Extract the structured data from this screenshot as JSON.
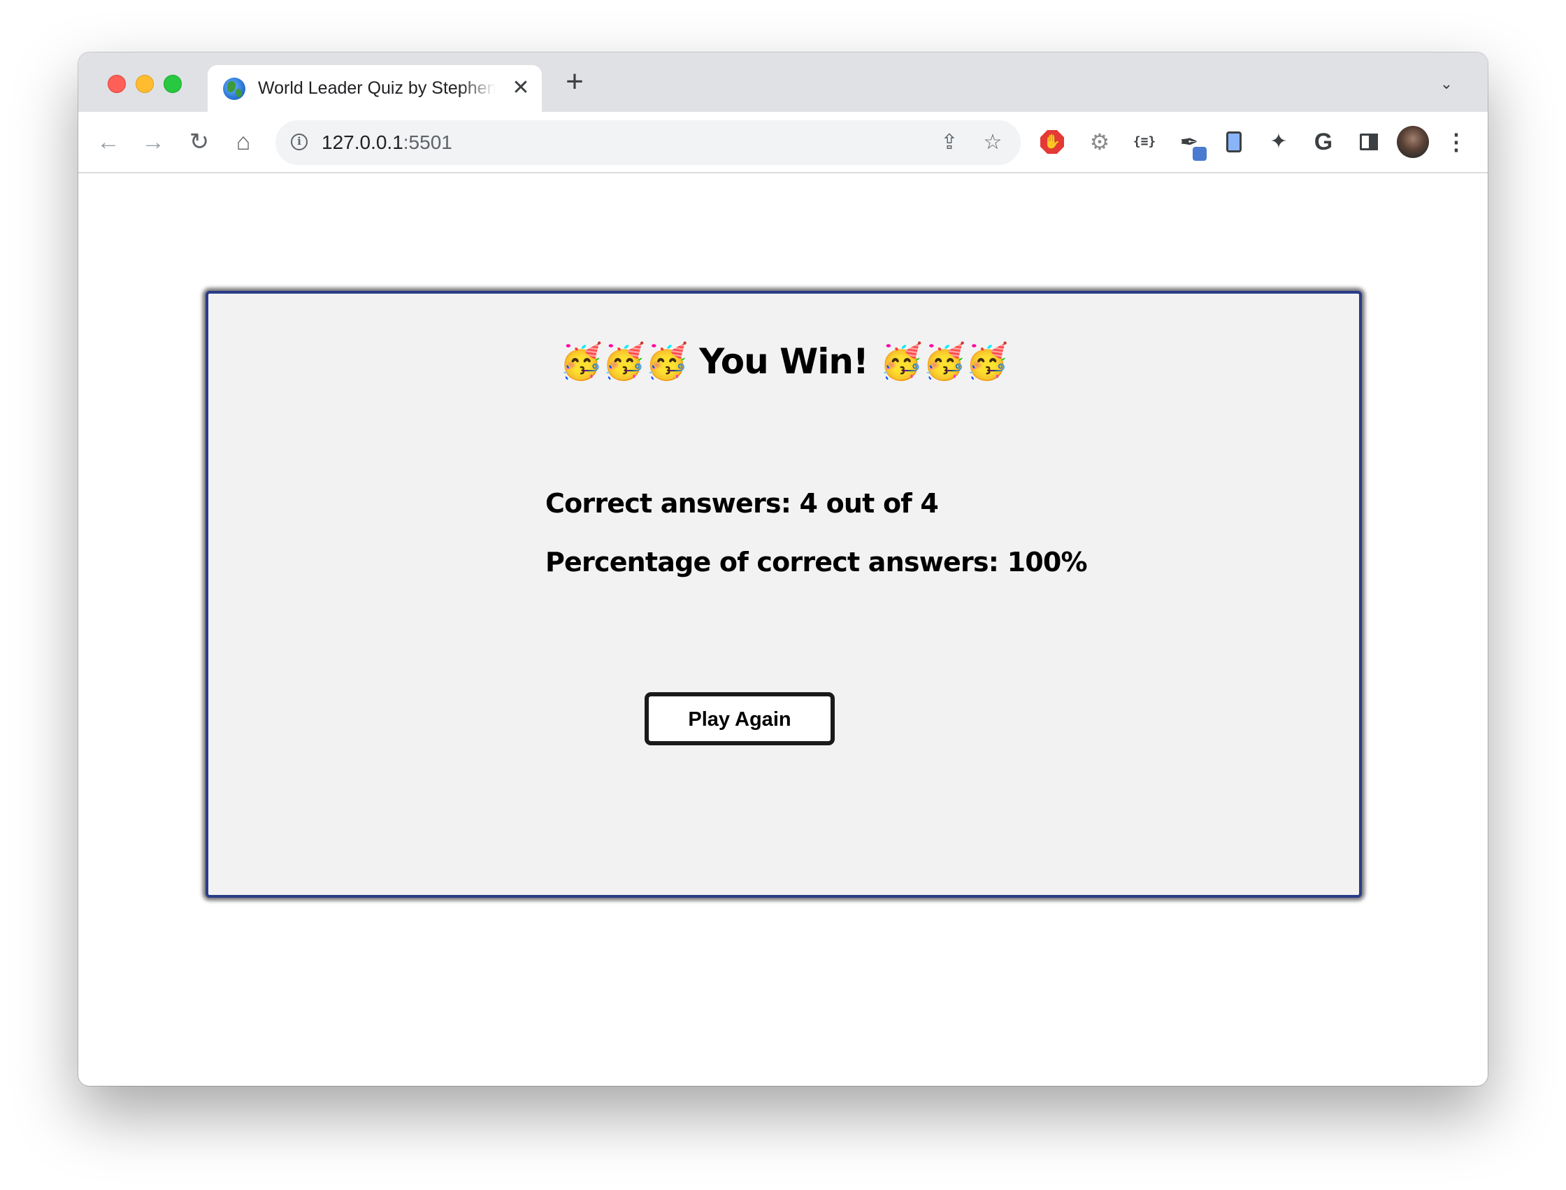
{
  "browser": {
    "tab": {
      "title": "World Leader Quiz by Stephen",
      "close_glyph": "✕",
      "favicon": "globe-icon"
    },
    "new_tab_glyph": "+",
    "tab_search_glyph": "⌄",
    "nav": {
      "back_glyph": "←",
      "forward_glyph": "→",
      "reload_glyph": "↻",
      "home_glyph": "⌂"
    },
    "omnibox": {
      "host": "127.0.0.1",
      "port": ":5501",
      "info_glyph": "i",
      "share_glyph": "⇪",
      "star_glyph": "☆"
    },
    "extensions": {
      "stop_glyph": "✋",
      "gear_glyph": "⚙",
      "json_glyph": "{≡}",
      "dropper_glyph": "✒",
      "puzzle_glyph": "✦",
      "google_glyph": "G",
      "menu_glyph": "⋮"
    }
  },
  "quiz": {
    "title": "🥳🥳🥳 You Win! 🥳🥳🥳",
    "correct_answers": "Correct answers: 4 out of 4",
    "percentage": "Percentage of correct answers: 100%",
    "play_again_label": "Play Again"
  },
  "colors": {
    "card_border": "#2b3c88",
    "card_background": "#f2f2f2",
    "button_border": "#1a1a1a"
  }
}
